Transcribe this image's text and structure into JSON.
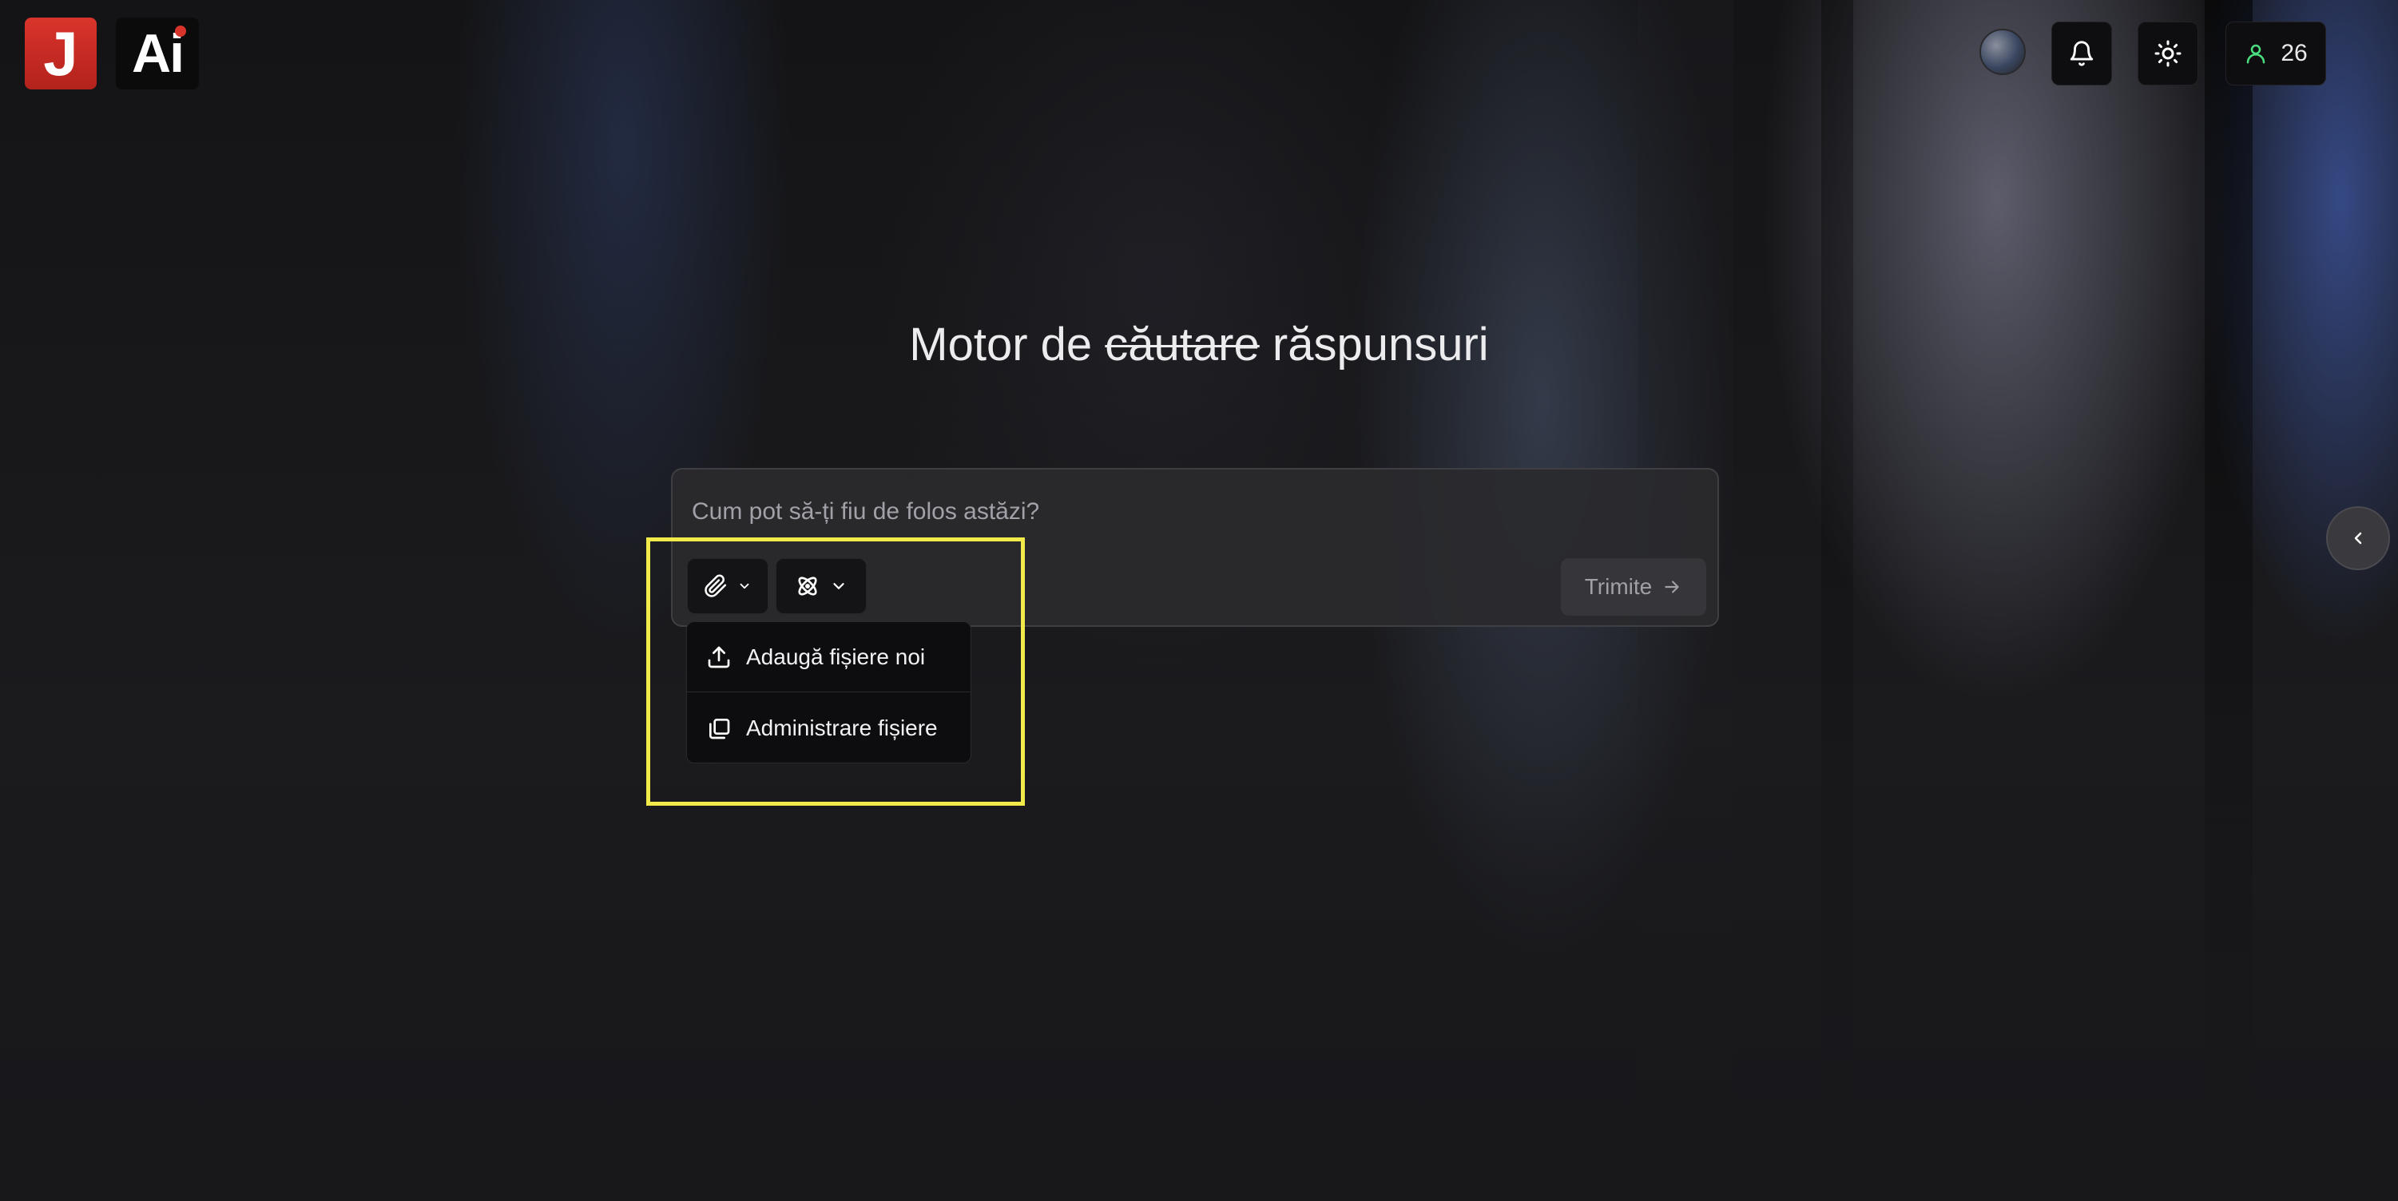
{
  "header": {
    "logo_j_text": "J",
    "logo_ai_text": "Ai",
    "users_count": "26",
    "icons": {
      "bell": "bell-icon",
      "theme": "sun-icon",
      "users": "user-icon"
    }
  },
  "hero": {
    "title_before": "Motor de ",
    "title_struck": "căutare",
    "title_after": " răspunsuri"
  },
  "prompt": {
    "placeholder": "Cum pot să-ți fiu de folos astăzi?",
    "send_label": "Trimite",
    "tools": {
      "attach_icon": "paperclip-icon",
      "model_icon": "atom-icon"
    }
  },
  "attach_menu": {
    "items": [
      {
        "label": "Adaugă fișiere noi",
        "icon": "upload-icon"
      },
      {
        "label": "Administrare fișiere",
        "icon": "files-icon"
      }
    ]
  },
  "colors": {
    "highlight": "#f2e94a",
    "brand_red": "#d9342b",
    "users_icon": "#4ade80"
  }
}
